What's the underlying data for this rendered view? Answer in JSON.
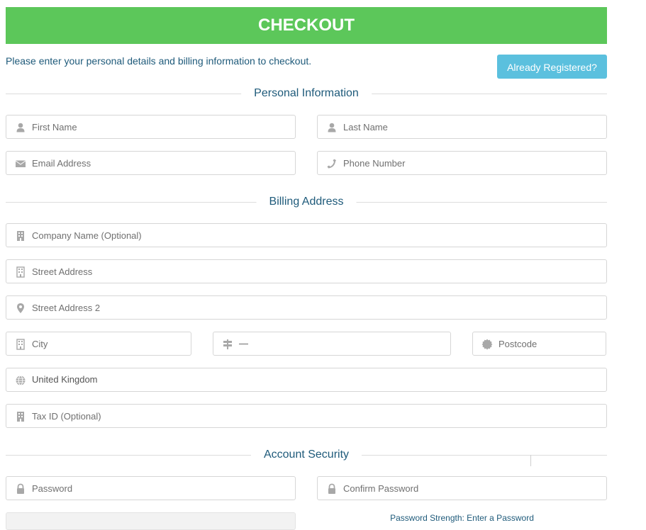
{
  "header": {
    "title": "CHECKOUT",
    "color": "#5cc75a"
  },
  "intro": {
    "text": "Please enter your personal details and billing information to checkout."
  },
  "already_registered": {
    "label": "Already Registered?",
    "color": "#5bc0de"
  },
  "sections": {
    "personal": "Personal Information",
    "billing": "Billing Address",
    "security": "Account Security"
  },
  "fields": {
    "first_name": {
      "placeholder": "First Name",
      "icon": "user-icon"
    },
    "last_name": {
      "placeholder": "Last Name",
      "icon": "user-icon"
    },
    "email": {
      "placeholder": "Email Address",
      "icon": "envelope-icon"
    },
    "phone": {
      "placeholder": "Phone Number",
      "icon": "phone-icon"
    },
    "company": {
      "placeholder": "Company Name (Optional)",
      "icon": "building-icon"
    },
    "street": {
      "placeholder": "Street Address",
      "icon": "building-icon"
    },
    "street2": {
      "placeholder": "Street Address 2",
      "icon": "map-marker-icon"
    },
    "city": {
      "placeholder": "City",
      "icon": "building-icon"
    },
    "state": {
      "value": "—",
      "icon": "signpost-icon"
    },
    "postcode": {
      "placeholder": "Postcode",
      "icon": "certificate-icon"
    },
    "country": {
      "value": "United Kingdom",
      "icon": "globe-icon"
    },
    "tax_id": {
      "placeholder": "Tax ID (Optional)",
      "icon": "building-icon"
    },
    "password": {
      "placeholder": "Password",
      "icon": "lock-icon"
    },
    "confirm_password": {
      "placeholder": "Confirm Password",
      "icon": "lock-icon"
    }
  },
  "password_strength": {
    "text": "Password Strength: Enter a Password",
    "level": 0
  }
}
